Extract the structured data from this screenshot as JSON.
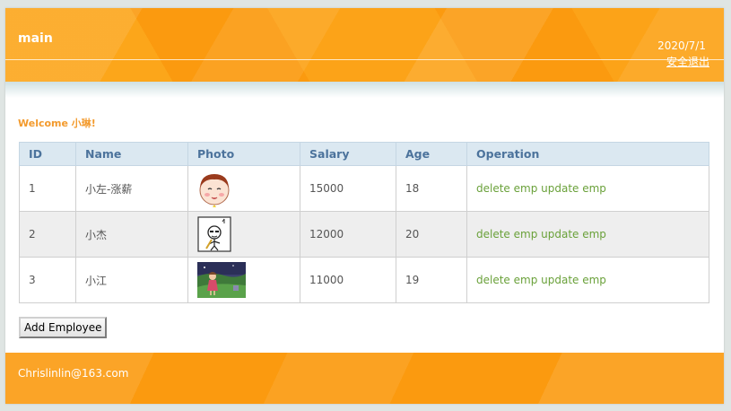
{
  "header": {
    "title": "main",
    "date": "2020/7/1",
    "logout_label": "安全退出"
  },
  "welcome": "Welcome 小琳!",
  "table": {
    "columns": [
      "ID",
      "Name",
      "Photo",
      "Salary",
      "Age",
      "Operation"
    ],
    "rows": [
      {
        "id": "1",
        "name": "小左-涨薪",
        "photo": "cartoon-girl-face",
        "salary": "15000",
        "age": "18",
        "delete_label": "delete emp",
        "update_label": "update emp"
      },
      {
        "id": "2",
        "name": "小杰",
        "photo": "cartoon-doodle-figure",
        "salary": "12000",
        "age": "20",
        "delete_label": "delete emp",
        "update_label": "update emp"
      },
      {
        "id": "3",
        "name": "小江",
        "photo": "anime-meadow-scene",
        "salary": "11000",
        "age": "19",
        "delete_label": "delete emp",
        "update_label": "update emp"
      }
    ]
  },
  "add_button_label": "Add Employee",
  "footer": {
    "email": "Chrislinlin@163.com"
  },
  "colors": {
    "header_orange": "#fb9a0f",
    "welcome_orange": "#f39a2c",
    "table_header_bg": "#dbe8f1",
    "table_header_text": "#4c739c",
    "operation_green": "#6aa13a"
  }
}
